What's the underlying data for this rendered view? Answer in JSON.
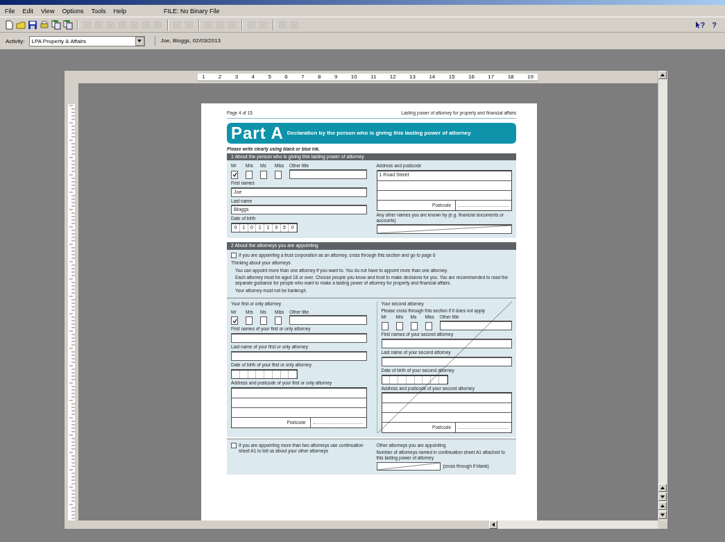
{
  "menu": [
    {
      "label": "File"
    },
    {
      "label": "Edit"
    },
    {
      "label": "View"
    },
    {
      "label": "Options"
    },
    {
      "label": "Tools"
    },
    {
      "label": "Help"
    }
  ],
  "file_label": "FILE: No Binary File",
  "toolbar": [
    {
      "kind": "new",
      "disabled": false
    },
    {
      "kind": "open",
      "disabled": false
    },
    {
      "kind": "save",
      "disabled": false
    },
    {
      "kind": "print",
      "disabled": false
    },
    {
      "kind": "docs",
      "disabled": false
    },
    {
      "kind": "docs",
      "disabled": false
    },
    {
      "kind": "separator"
    },
    {
      "kind": "generic",
      "disabled": true
    },
    {
      "kind": "generic",
      "disabled": true
    },
    {
      "kind": "generic",
      "disabled": true
    },
    {
      "kind": "generic",
      "disabled": true
    },
    {
      "kind": "generic",
      "disabled": true
    },
    {
      "kind": "generic",
      "disabled": true
    },
    {
      "kind": "generic",
      "disabled": true
    },
    {
      "kind": "separator"
    },
    {
      "kind": "generic",
      "disabled": true
    },
    {
      "kind": "generic",
      "disabled": true
    },
    {
      "kind": "separator"
    },
    {
      "kind": "generic",
      "disabled": true
    },
    {
      "kind": "generic",
      "disabled": true
    },
    {
      "kind": "generic",
      "disabled": true
    },
    {
      "kind": "separator"
    },
    {
      "kind": "generic",
      "disabled": true
    },
    {
      "kind": "generic",
      "disabled": true
    },
    {
      "kind": "separator"
    },
    {
      "kind": "generic",
      "disabled": true
    },
    {
      "kind": "generic",
      "disabled": true
    }
  ],
  "help_buttons": [
    {
      "kind": "context",
      "symbol": "?"
    },
    {
      "kind": "plain",
      "symbol": "?"
    }
  ],
  "activity": {
    "label": "Activity:",
    "value": "LPA Property & Affairs",
    "client": "Joe, Bloggs, 02/03/2013"
  },
  "ruler": {
    "labels": [
      "1",
      "2",
      "3",
      "4",
      "5",
      "6",
      "7",
      "8",
      "9",
      "10",
      "11",
      "12",
      "13",
      "14",
      "15",
      "16",
      "17",
      "18",
      "19"
    ]
  },
  "page": {
    "page_number": "Page 4 of 15",
    "running_title": "Lasting power of attorney for property and financial affairs",
    "part": {
      "title": "Part A",
      "subtitle": "Declaration by the person who is giving this lasting power of attorney"
    },
    "instruction": "Please write clearly using black or blue ink.",
    "section1": {
      "heading": "1  About the person who is giving this lasting power of attorney",
      "titles": [
        {
          "label": "Mr",
          "checked": true
        },
        {
          "label": "Mrs",
          "checked": false
        },
        {
          "label": "Ms",
          "checked": false
        },
        {
          "label": "Miss",
          "checked": false
        }
      ],
      "other_title_label": "Other title",
      "first_names": {
        "label": "First names",
        "value": "Joe"
      },
      "last_name": {
        "label": "Last name",
        "value": "Bloggs"
      },
      "dob": {
        "label": "Date of birth",
        "digits": [
          "0",
          "1",
          "0",
          "1",
          "1",
          "9",
          "5",
          "0"
        ]
      },
      "address": {
        "label": "Address and postcode",
        "lines": [
          "1 Road Street"
        ],
        "postcode_label": "Postcode"
      },
      "other_names": {
        "label": "Any other names you are known by (e.g. financial documents or accounts)",
        "crossed_through": true
      }
    },
    "section2": {
      "heading": "2  About the attorneys you are appointing",
      "trust_option": {
        "text": "If you are appointing a trust corporation as an attorney, cross through this section and go to page 6",
        "checked": false
      },
      "notes_heading": "Thinking about your attorneys",
      "notes": [
        "You can appoint more than one attorney if you want to. You do not have to appoint more than one attorney.",
        "Each attorney must be aged 18 or over. Choose people you know and trust to make decisions for you. You are recommended to read the separate guidance for people who want to make a lasting power of attorney for property and financial affairs.",
        "Your attorney must not be bankrupt."
      ],
      "attorneys": [
        {
          "heading": "Your first or only attorney",
          "titles": [
            {
              "label": "Mr",
              "checked": true
            },
            {
              "label": "Mrs",
              "checked": false
            },
            {
              "label": "Ms",
              "checked": false
            },
            {
              "label": "Miss",
              "checked": false
            }
          ],
          "other_title_label": "Other title",
          "first_names_label": "First names of your first or only attorney",
          "last_name_label": "Last name of your first or only attorney",
          "dob_label": "Date of birth of your first or only attorney",
          "address_label": "Address and postcode of your first or only attorney",
          "postcode_label": "Postcode",
          "crossed_through": false
        },
        {
          "heading": "Your second attorney",
          "note": "Please cross through this section if it does not apply",
          "titles": [
            {
              "label": "Mr",
              "checked": false
            },
            {
              "label": "Mrs",
              "checked": false
            },
            {
              "label": "Ms",
              "checked": false
            },
            {
              "label": "Miss",
              "checked": false
            }
          ],
          "other_title_label": "Other title",
          "first_names_label": "First names of your second attorney",
          "last_name_label": "Last name of your second attorney",
          "dob_label": "Date of birth of your second attorney",
          "address_label": "Address and postcode of your second attorney",
          "postcode_label": "Postcode",
          "crossed_through": true
        }
      ],
      "more_option": {
        "text": "If you are appointing more than two attorneys use continuation sheet A1 to tell us about your other attorneys",
        "checked": false
      },
      "other_attorneys": {
        "heading": "Other attorneys you are appointing",
        "text": "Number of attorneys named in continuation sheet A1 attached to this lasting power of attorney",
        "hint": "(cross through if blank)",
        "crossed_through": true
      }
    }
  }
}
